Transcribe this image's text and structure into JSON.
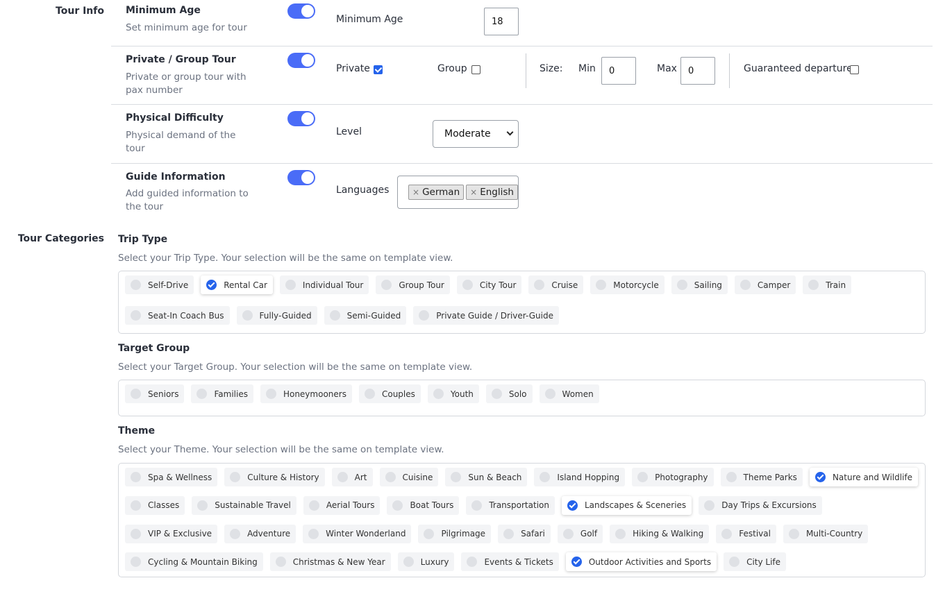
{
  "tour_info": {
    "section_label": "Tour Info",
    "minimum_age": {
      "title": "Minimum Age",
      "description": "Set minimum age for tour",
      "field_label": "Minimum Age",
      "value": "18"
    },
    "private_group": {
      "title": "Private / Group Tour",
      "description": "Private or group tour with pax number",
      "private_label": "Private",
      "private_checked": true,
      "group_label": "Group",
      "group_checked": false,
      "size_label": "Size:",
      "min_label": "Min",
      "min_value": "0",
      "max_label": "Max",
      "max_value": "0",
      "guaranteed_label": "Guaranteed departure",
      "guaranteed_checked": false
    },
    "physical_difficulty": {
      "title": "Physical Difficulty",
      "description": "Physical demand of the tour",
      "level_label": "Level",
      "level_value": "Moderate"
    },
    "guide_information": {
      "title": "Guide Information",
      "description": "Add guided information to the tour",
      "languages_label": "Languages",
      "languages": [
        "German",
        "English"
      ],
      "remove_symbol": "×"
    }
  },
  "tour_categories": {
    "section_label": "Tour Categories",
    "groups": [
      {
        "title": "Trip Type",
        "hint": "Select your Trip Type. Your selection will be the same on template view.",
        "options": [
          {
            "label": "Self-Drive",
            "selected": false
          },
          {
            "label": "Rental Car",
            "selected": true
          },
          {
            "label": "Individual Tour",
            "selected": false
          },
          {
            "label": "Group Tour",
            "selected": false
          },
          {
            "label": "City Tour",
            "selected": false
          },
          {
            "label": "Cruise",
            "selected": false
          },
          {
            "label": "Motorcycle",
            "selected": false
          },
          {
            "label": "Sailing",
            "selected": false
          },
          {
            "label": "Camper",
            "selected": false
          },
          {
            "label": "Train",
            "selected": false
          },
          {
            "label": "Seat-In Coach Bus",
            "selected": false
          },
          {
            "label": "Fully-Guided",
            "selected": false
          },
          {
            "label": "Semi-Guided",
            "selected": false
          },
          {
            "label": "Private Guide / Driver-Guide",
            "selected": false
          }
        ]
      },
      {
        "title": "Target Group",
        "hint": "Select your Target Group. Your selection will be the same on template view.",
        "options": [
          {
            "label": "Seniors",
            "selected": false
          },
          {
            "label": "Families",
            "selected": false
          },
          {
            "label": "Honeymooners",
            "selected": false
          },
          {
            "label": "Couples",
            "selected": false
          },
          {
            "label": "Youth",
            "selected": false
          },
          {
            "label": "Solo",
            "selected": false
          },
          {
            "label": "Women",
            "selected": false
          }
        ]
      },
      {
        "title": "Theme",
        "hint": "Select your Theme. Your selection will be the same on template view.",
        "options": [
          {
            "label": "Spa & Wellness",
            "selected": false
          },
          {
            "label": "Culture & History",
            "selected": false
          },
          {
            "label": "Art",
            "selected": false
          },
          {
            "label": "Cuisine",
            "selected": false
          },
          {
            "label": "Sun & Beach",
            "selected": false
          },
          {
            "label": "Island Hopping",
            "selected": false
          },
          {
            "label": "Photography",
            "selected": false
          },
          {
            "label": "Theme Parks",
            "selected": false
          },
          {
            "label": "Nature and Wildlife",
            "selected": true
          },
          {
            "label": "Classes",
            "selected": false
          },
          {
            "label": "Sustainable Travel",
            "selected": false
          },
          {
            "label": "Aerial Tours",
            "selected": false
          },
          {
            "label": "Boat Tours",
            "selected": false
          },
          {
            "label": "Transportation",
            "selected": false
          },
          {
            "label": "Landscapes & Sceneries",
            "selected": true
          },
          {
            "label": "Day Trips & Excursions",
            "selected": false
          },
          {
            "label": "VIP & Exclusive",
            "selected": false
          },
          {
            "label": "Adventure",
            "selected": false
          },
          {
            "label": "Winter Wonderland",
            "selected": false
          },
          {
            "label": "Pilgrimage",
            "selected": false
          },
          {
            "label": "Safari",
            "selected": false
          },
          {
            "label": "Golf",
            "selected": false
          },
          {
            "label": "Hiking & Walking",
            "selected": false
          },
          {
            "label": "Festival",
            "selected": false
          },
          {
            "label": "Multi-Country",
            "selected": false
          },
          {
            "label": "Cycling & Mountain Biking",
            "selected": false
          },
          {
            "label": "Christmas & New Year",
            "selected": false
          },
          {
            "label": "Luxury",
            "selected": false
          },
          {
            "label": "Events & Tickets",
            "selected": false
          },
          {
            "label": "Outdoor Activities and Sports",
            "selected": true
          },
          {
            "label": "City Life",
            "selected": false
          }
        ]
      }
    ]
  },
  "colors": {
    "accent": "#4a6cf7",
    "checked": "#2563eb",
    "muted_text": "#6b7280"
  }
}
